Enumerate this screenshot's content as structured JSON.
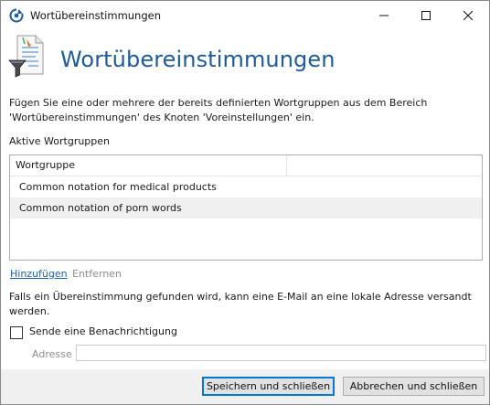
{
  "window": {
    "title": "Wortübereinstimmungen",
    "app_icon": "refresh-shield-icon",
    "controls": {
      "minimize": "minimize-icon",
      "maximize": "maximize-icon",
      "close": "close-icon"
    }
  },
  "header": {
    "icon": "document-funnel-icon",
    "title": "Wortübereinstimmungen"
  },
  "description": "Fügen Sie eine oder mehrere der bereits definierten Wortgruppen aus dem Bereich 'Wortübereinstimmungen' des Knoten 'Voreinstellungen' ein.",
  "active_groups": {
    "label": "Aktive Wortgruppen",
    "columns": [
      "Wortgruppe"
    ],
    "rows": [
      {
        "name": "Common notation for medical products"
      },
      {
        "name": "Common notation of porn words"
      }
    ],
    "add_link": "Hinzufügen",
    "remove_link": "Entfernen"
  },
  "notification": {
    "info": "Falls ein Übereinstimmung gefunden wird, kann eine E-Mail an eine lokale Adresse versandt werden.",
    "checkbox_label": "Sende eine Benachrichtigung",
    "checked": false,
    "address_label": "Adresse",
    "address_value": ""
  },
  "footer": {
    "save_label": "Speichern und schließen",
    "cancel_label": "Abbrechen und schließen"
  },
  "colors": {
    "accent": "#1e5b9c",
    "link": "#1a5fb4",
    "disabled": "#8d8d8d",
    "selected_row": "#f0f0f0"
  }
}
